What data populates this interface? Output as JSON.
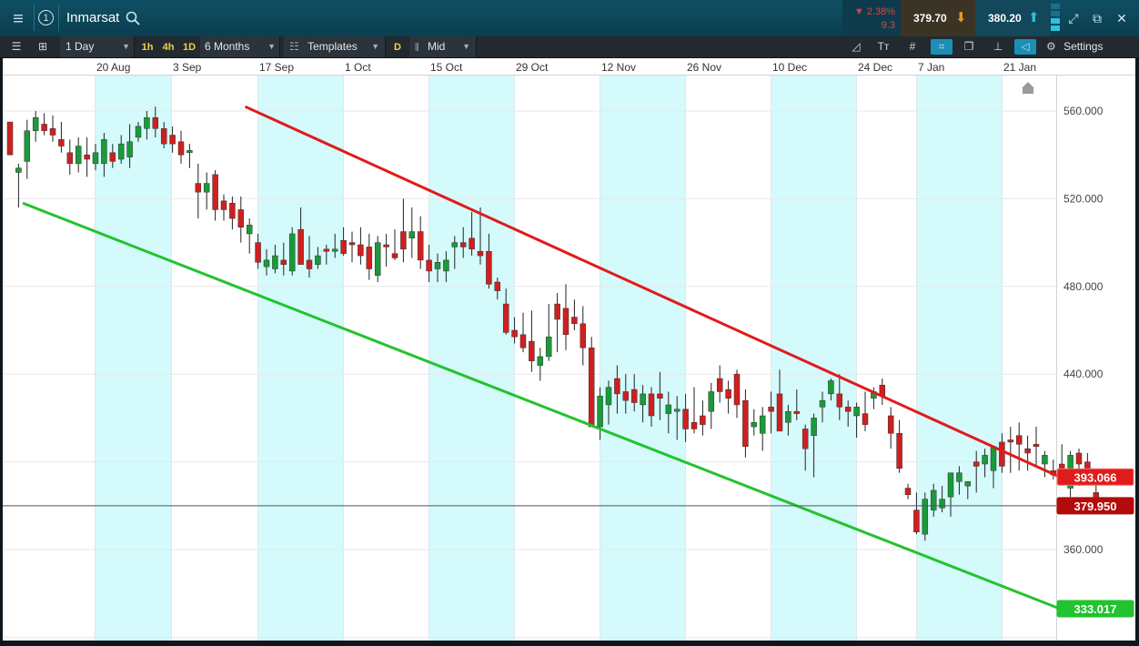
{
  "header": {
    "menu_icon": "hamburger-menu-icon",
    "link_number": "1",
    "title": "Inmarsat",
    "search_icon": "search-icon",
    "change_percent": "▼ 2.38%",
    "change_abs": "9.3",
    "sell_price": "379.70",
    "buy_price": "380.20",
    "colors": {
      "down": "#e2423a",
      "sell_arrow": "#e29a2a",
      "buy_arrow": "#39b9d9"
    }
  },
  "toolbar": {
    "interval": "1 Day",
    "quick_intervals": [
      "1h",
      "4h",
      "1D"
    ],
    "range": "6 Months",
    "templates": "Templates",
    "d_badge": "D",
    "price_type": "Mid",
    "settings": "Settings"
  },
  "chart_data": {
    "type": "candlestick",
    "x_tick_labels": [
      "20 Aug",
      "3 Sep",
      "17 Sep",
      "1 Oct",
      "15 Oct",
      "29 Oct",
      "12 Nov",
      "26 Nov",
      "10 Dec",
      "24 Dec",
      "7 Jan",
      "21 Jan"
    ],
    "y_tick_labels": [
      "560.000",
      "520.000",
      "480.000",
      "440.000",
      "360.000"
    ],
    "y_ticks": [
      560,
      520,
      480,
      440,
      360
    ],
    "ylim": [
      325,
      585
    ],
    "grid": true,
    "current_price_label": "379.950",
    "current_price": 379.95,
    "upper_line_label": "393.066",
    "upper_line": {
      "color": "#e01b1b",
      "start": {
        "x_index": 27.5,
        "y": 562
      },
      "end_value": 393.066
    },
    "lower_line_label": "333.017",
    "lower_line": {
      "color": "#22c32e",
      "start": {
        "x_index": 1.5,
        "y": 518
      },
      "end_value": 333.017
    },
    "colors": {
      "up": "#1a9a3a",
      "down": "#cf1f1f",
      "band": "#d4fafc"
    },
    "candles": [
      [
        555,
        555,
        540,
        540
      ],
      [
        532,
        536,
        516,
        534
      ],
      [
        537,
        556,
        529,
        551
      ],
      [
        551,
        560,
        546,
        557
      ],
      [
        554,
        559,
        549,
        551
      ],
      [
        552,
        558,
        546,
        549
      ],
      [
        547,
        555,
        541,
        544
      ],
      [
        541,
        547,
        531,
        536
      ],
      [
        536,
        548,
        532,
        544
      ],
      [
        540,
        548,
        530,
        538
      ],
      [
        536,
        545,
        533,
        541
      ],
      [
        536,
        550,
        530,
        547
      ],
      [
        541,
        545,
        534,
        537
      ],
      [
        538,
        549,
        536,
        545
      ],
      [
        539,
        554,
        534,
        546
      ],
      [
        548,
        555,
        546,
        553
      ],
      [
        552,
        560,
        547,
        557
      ],
      [
        557,
        562,
        548,
        552
      ],
      [
        552,
        555,
        543,
        545
      ],
      [
        549,
        553,
        541,
        545
      ],
      [
        546,
        551,
        536,
        540
      ],
      [
        541,
        545,
        534,
        542
      ],
      [
        527,
        536,
        511,
        523
      ],
      [
        523,
        532,
        515,
        527
      ],
      [
        531,
        533,
        510,
        515
      ],
      [
        519,
        522,
        510,
        515
      ],
      [
        518,
        521,
        506,
        511
      ],
      [
        515,
        521,
        500,
        507
      ],
      [
        504,
        511,
        495,
        508
      ],
      [
        500,
        504,
        488,
        491
      ],
      [
        489,
        497,
        485,
        492
      ],
      [
        488,
        499,
        486,
        494
      ],
      [
        492,
        500,
        485,
        490
      ],
      [
        487,
        507,
        485,
        504
      ],
      [
        506,
        516,
        490,
        490
      ],
      [
        492,
        503,
        484,
        488
      ],
      [
        490,
        498,
        488,
        494
      ],
      [
        497,
        499,
        490,
        496
      ],
      [
        496,
        504,
        493,
        497
      ],
      [
        501,
        507,
        494,
        495
      ],
      [
        500,
        505,
        491,
        499
      ],
      [
        499,
        507,
        490,
        494
      ],
      [
        498,
        504,
        483,
        488
      ],
      [
        485,
        503,
        482,
        500
      ],
      [
        499,
        504,
        489,
        498
      ],
      [
        495,
        506,
        492,
        493
      ],
      [
        505,
        520,
        491,
        497
      ],
      [
        502,
        516,
        493,
        505
      ],
      [
        505,
        512,
        488,
        492
      ],
      [
        492,
        499,
        482,
        487
      ],
      [
        488,
        495,
        482,
        491
      ],
      [
        487,
        496,
        482,
        492
      ],
      [
        498,
        503,
        488,
        500
      ],
      [
        500,
        507,
        493,
        498
      ],
      [
        502,
        514,
        494,
        497
      ],
      [
        496,
        516,
        490,
        494
      ],
      [
        496,
        504,
        479,
        481
      ],
      [
        482,
        484,
        474,
        478
      ],
      [
        472,
        479,
        458,
        459
      ],
      [
        460,
        466,
        454,
        457
      ],
      [
        458,
        468,
        450,
        452
      ],
      [
        455,
        469,
        441,
        446
      ],
      [
        444,
        452,
        437,
        448
      ],
      [
        448,
        472,
        446,
        457
      ],
      [
        472,
        477,
        450,
        465
      ],
      [
        470,
        481,
        451,
        458
      ],
      [
        466,
        474,
        460,
        463
      ],
      [
        463,
        471,
        444,
        452
      ],
      [
        452,
        457,
        416,
        416
      ],
      [
        416,
        434,
        410,
        430
      ],
      [
        426,
        437,
        417,
        434
      ],
      [
        438,
        444,
        422,
        431
      ],
      [
        432,
        440,
        422,
        428
      ],
      [
        433,
        440,
        423,
        427
      ],
      [
        426,
        435,
        418,
        431
      ],
      [
        431,
        434,
        416,
        421
      ],
      [
        431,
        441,
        419,
        429
      ],
      [
        422,
        432,
        413,
        426
      ],
      [
        423,
        430,
        410,
        424
      ],
      [
        424,
        431,
        409,
        415
      ],
      [
        418,
        434,
        413,
        415
      ],
      [
        421,
        428,
        412,
        417
      ],
      [
        423,
        436,
        415,
        432
      ],
      [
        438,
        444,
        427,
        432
      ],
      [
        433,
        437,
        422,
        429
      ],
      [
        440,
        442,
        420,
        426
      ],
      [
        428,
        433,
        402,
        407
      ],
      [
        416,
        424,
        412,
        418
      ],
      [
        413,
        425,
        405,
        421
      ],
      [
        425,
        432,
        413,
        423
      ],
      [
        431,
        442,
        416,
        414
      ],
      [
        418,
        426,
        412,
        423
      ],
      [
        423,
        433,
        419,
        422
      ],
      [
        415,
        417,
        396,
        406
      ],
      [
        412,
        422,
        393,
        420
      ],
      [
        425,
        432,
        418,
        428
      ],
      [
        431,
        438,
        428,
        437
      ],
      [
        431,
        440,
        419,
        425
      ],
      [
        425,
        428,
        416,
        423
      ],
      [
        421,
        427,
        411,
        425
      ],
      [
        422,
        432,
        414,
        417
      ],
      [
        429,
        434,
        424,
        432
      ],
      [
        435,
        438,
        426,
        430
      ],
      [
        421,
        425,
        406,
        413
      ],
      [
        413,
        419,
        395,
        397
      ],
      [
        388,
        390,
        383,
        385
      ],
      [
        378,
        386,
        367,
        368
      ],
      [
        367,
        386,
        364,
        383
      ],
      [
        378,
        390,
        375,
        387
      ],
      [
        379,
        389,
        377,
        383
      ],
      [
        384,
        394,
        375,
        395
      ],
      [
        391,
        398,
        385,
        395
      ],
      [
        389,
        391,
        383,
        391
      ],
      [
        400,
        405,
        386,
        398
      ],
      [
        399,
        406,
        393,
        403
      ],
      [
        396,
        406,
        388,
        407
      ],
      [
        409,
        413,
        395,
        398
      ],
      [
        410,
        416,
        395,
        409
      ],
      [
        412,
        418,
        396,
        408
      ],
      [
        406,
        412,
        396,
        404
      ],
      [
        408,
        416,
        398,
        407
      ],
      [
        399,
        405,
        393,
        403
      ],
      [
        396,
        401,
        392,
        394
      ],
      [
        399,
        408,
        390,
        397
      ],
      [
        388,
        405,
        384,
        403
      ],
      [
        404,
        406,
        389,
        399
      ],
      [
        400,
        404,
        390,
        396
      ],
      [
        386,
        394,
        377,
        379.95
      ]
    ]
  }
}
